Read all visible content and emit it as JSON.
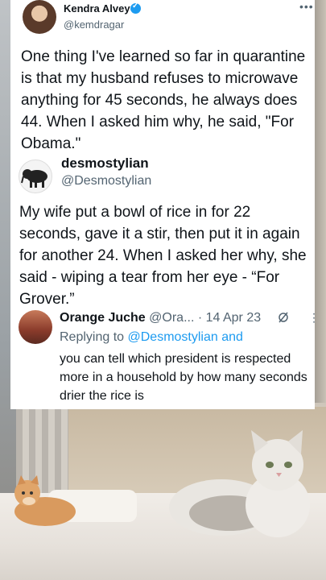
{
  "tweet1": {
    "name": "Kendra Alvey",
    "handle": "@kemdragar",
    "text": "One thing I've learned so far in quarantine is that my husband refuses to microwave anything for 45 seconds, he always does 44. When I asked him why, he said, \"For Obama.\"",
    "more_label": "•••"
  },
  "tweet2": {
    "name": "desmostylian",
    "handle": "@Desmostylian",
    "text": "My wife put a bowl of rice in for 22 seconds, gave it a stir, then put it in again for another 24. When I asked her why, she said - wiping a tear from her eye - “For Grover.”"
  },
  "reply": {
    "name": "Orange Juche",
    "meta": " @Ora... · 14 Apr 23",
    "replying_prefix": "Replying to ",
    "replying_link": "@Desmostylian and",
    "text": "you can tell which president is respected more in a household by how many seconds drier the rice is",
    "more_label": "⋮"
  },
  "colors": {
    "verified": "#1d9bf0",
    "link": "#1d9bf0",
    "secondary_text": "#536471"
  }
}
